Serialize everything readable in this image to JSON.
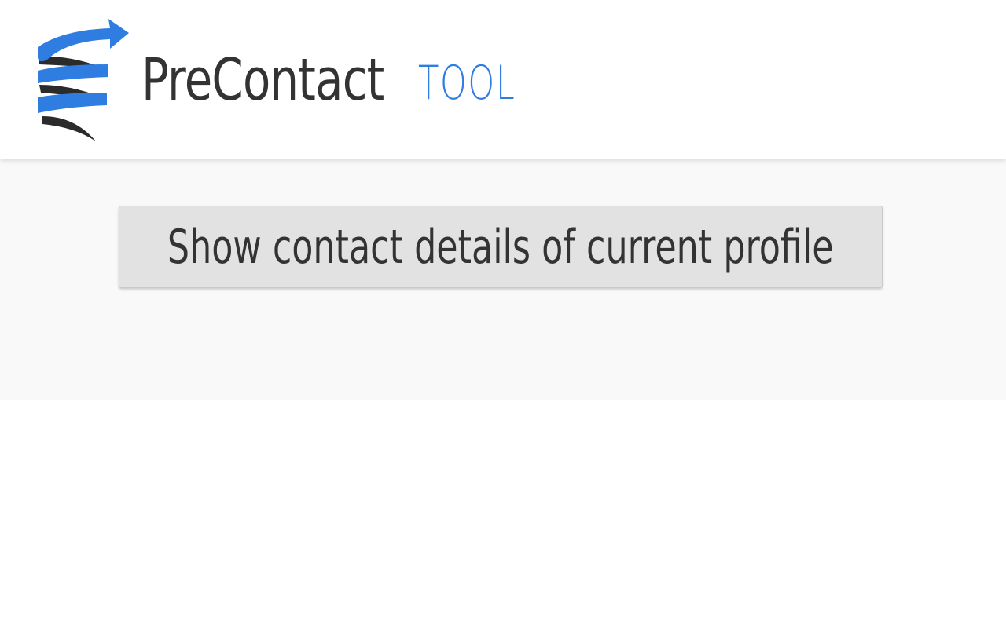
{
  "brand": {
    "name_main": "PreContact",
    "name_sub": "TOOL",
    "logo_icon": "spiral-arrow-icon",
    "colors": {
      "accent": "#2f7de1",
      "text": "#333333"
    }
  },
  "main": {
    "action_button_label": "Show contact details of current profile"
  },
  "colors": {
    "header_bg": "#ffffff",
    "content_bg": "#f9f9f9",
    "button_bg": "#e2e2e2"
  }
}
